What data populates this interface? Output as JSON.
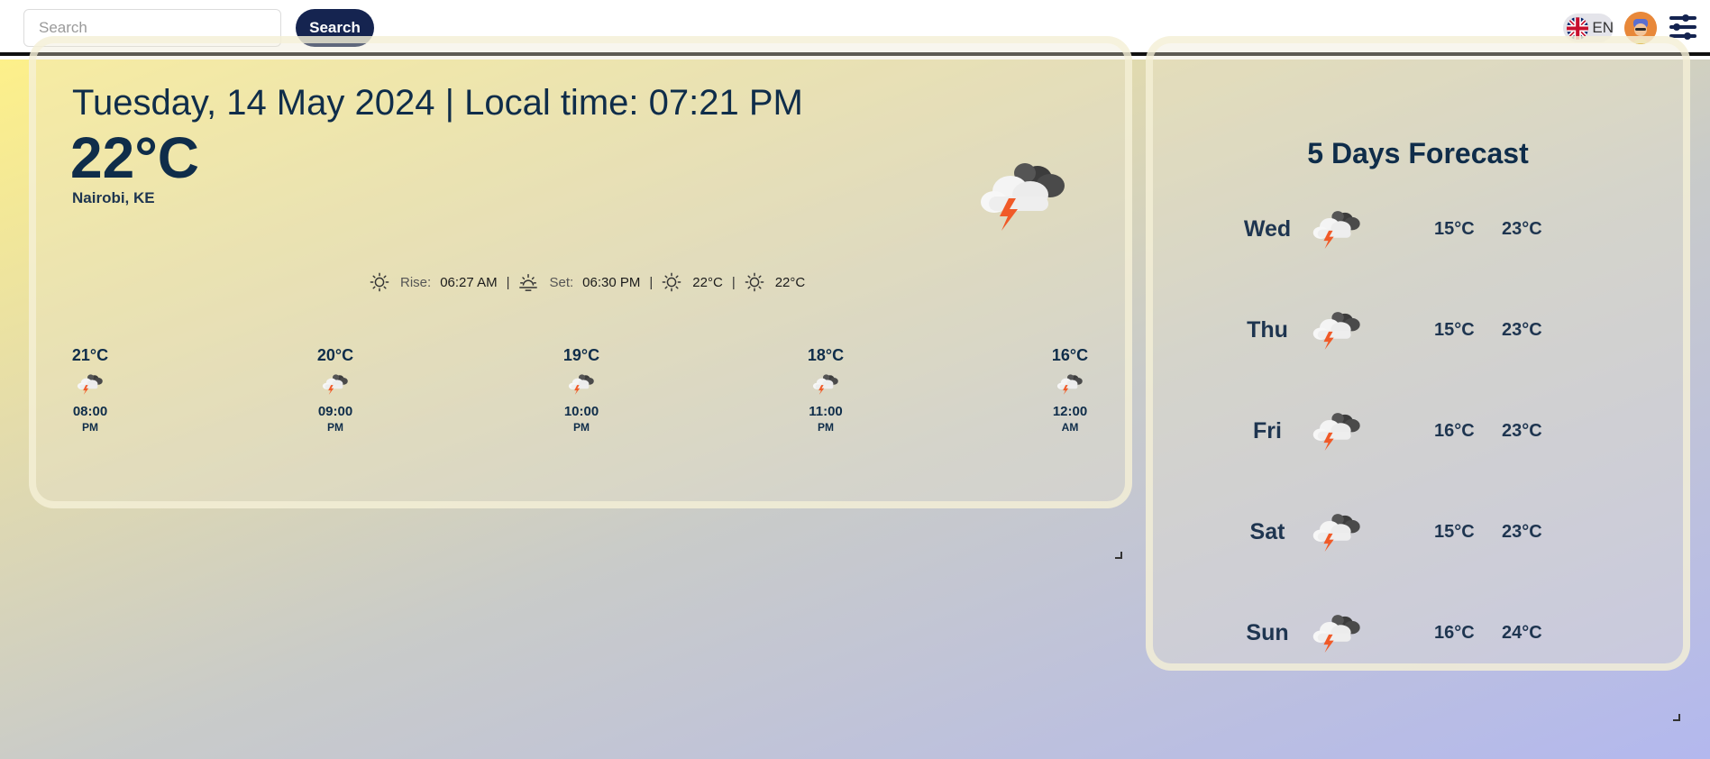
{
  "header": {
    "search_placeholder": "Search",
    "search_button": "Search",
    "language": "EN"
  },
  "current": {
    "date_line": "Tuesday, 14 May 2024 | Local time: 07:21 PM",
    "temperature": "22°C",
    "location": "Nairobi, KE",
    "icon": "thunderstorm-icon",
    "details": {
      "rise_label": "Rise:",
      "rise_value": "06:27 AM",
      "set_label": "Set:",
      "set_value": "06:30 PM",
      "high_value": "22°C",
      "low_value": "22°C"
    }
  },
  "hourly": [
    {
      "temp": "21°C",
      "time": "08:00",
      "ampm": "PM"
    },
    {
      "temp": "20°C",
      "time": "09:00",
      "ampm": "PM"
    },
    {
      "temp": "19°C",
      "time": "10:00",
      "ampm": "PM"
    },
    {
      "temp": "18°C",
      "time": "11:00",
      "ampm": "PM"
    },
    {
      "temp": "16°C",
      "time": "12:00",
      "ampm": "AM"
    }
  ],
  "forecast": {
    "title": "5 Days Forecast",
    "days": [
      {
        "day": "Wed",
        "low": "15°C",
        "high": "23°C"
      },
      {
        "day": "Thu",
        "low": "15°C",
        "high": "23°C"
      },
      {
        "day": "Fri",
        "low": "16°C",
        "high": "23°C"
      },
      {
        "day": "Sat",
        "low": "15°C",
        "high": "23°C"
      },
      {
        "day": "Sun",
        "low": "16°C",
        "high": "24°C"
      }
    ]
  },
  "colors": {
    "primary_text": "#0f2d4a",
    "search_button_bg": "#152450",
    "lightning": "#f05a28"
  }
}
